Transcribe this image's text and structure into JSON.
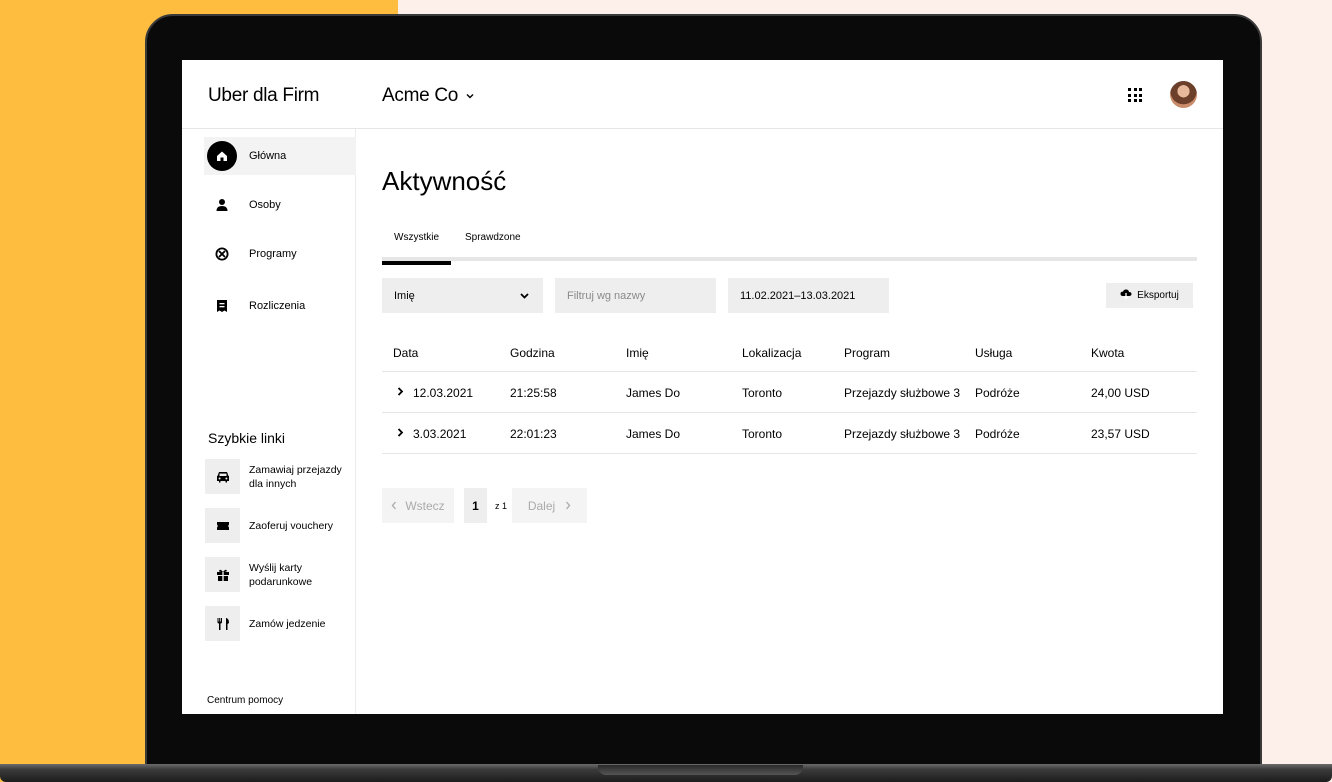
{
  "header": {
    "brand": "Uber dla Firm",
    "organization": "Acme Co",
    "organization_chevron": "⌄"
  },
  "sidebar": {
    "items": [
      {
        "label": "Główna",
        "icon": "home-icon",
        "active": true
      },
      {
        "label": "Osoby",
        "icon": "person-icon",
        "active": false
      },
      {
        "label": "Programy",
        "icon": "program-icon",
        "active": false
      },
      {
        "label": "Rozliczenia",
        "icon": "receipt-icon",
        "active": false
      }
    ],
    "quick_links_title": "Szybkie linki",
    "quick_links": [
      {
        "label_line1": "Zamawiaj przejazdy",
        "label_line2": "dla innych",
        "icon": "car-icon"
      },
      {
        "label_line1": "Zaoferuj vouchery",
        "label_line2": "",
        "icon": "ticket-icon"
      },
      {
        "label_line1": "Wyślij karty",
        "label_line2": "podarunkowe",
        "icon": "gift-icon"
      },
      {
        "label_line1": "Zamów jedzenie",
        "label_line2": "",
        "icon": "cutlery-icon"
      }
    ],
    "help": "Centrum pomocy"
  },
  "main": {
    "title": "Aktywność",
    "tabs": [
      {
        "label": "Wszystkie",
        "active": true
      },
      {
        "label": "Sprawdzone",
        "active": false
      }
    ],
    "filters": {
      "select_value": "Imię",
      "search_placeholder": "Filtruj wg nazwy",
      "date_range": "11.02.2021–13.03.2021"
    },
    "export_label": "Eksportuj",
    "table": {
      "columns": [
        "Data",
        "Godzina",
        "Imię",
        "Lokalizacja",
        "Program",
        "Usługa",
        "Kwota"
      ],
      "rows": [
        [
          "12.03.2021",
          "21:25:58",
          "James Do",
          "Toronto",
          "Przejazdy służbowe 3",
          "Podróże",
          "24,00 USD"
        ],
        [
          "3.03.2021",
          "22:01:23",
          "James Do",
          "Toronto",
          "Przejazdy służbowe 3",
          "Podróże",
          "23,57 USD"
        ]
      ]
    },
    "pagination": {
      "prev": "Wstecz",
      "page": "1",
      "of": "z 1",
      "next": "Dalej"
    }
  },
  "colors": {
    "background_left": "#ffbd40",
    "background_right": "#fdf0ea",
    "accent": "#000000",
    "control_bg": "#eeeeee"
  }
}
